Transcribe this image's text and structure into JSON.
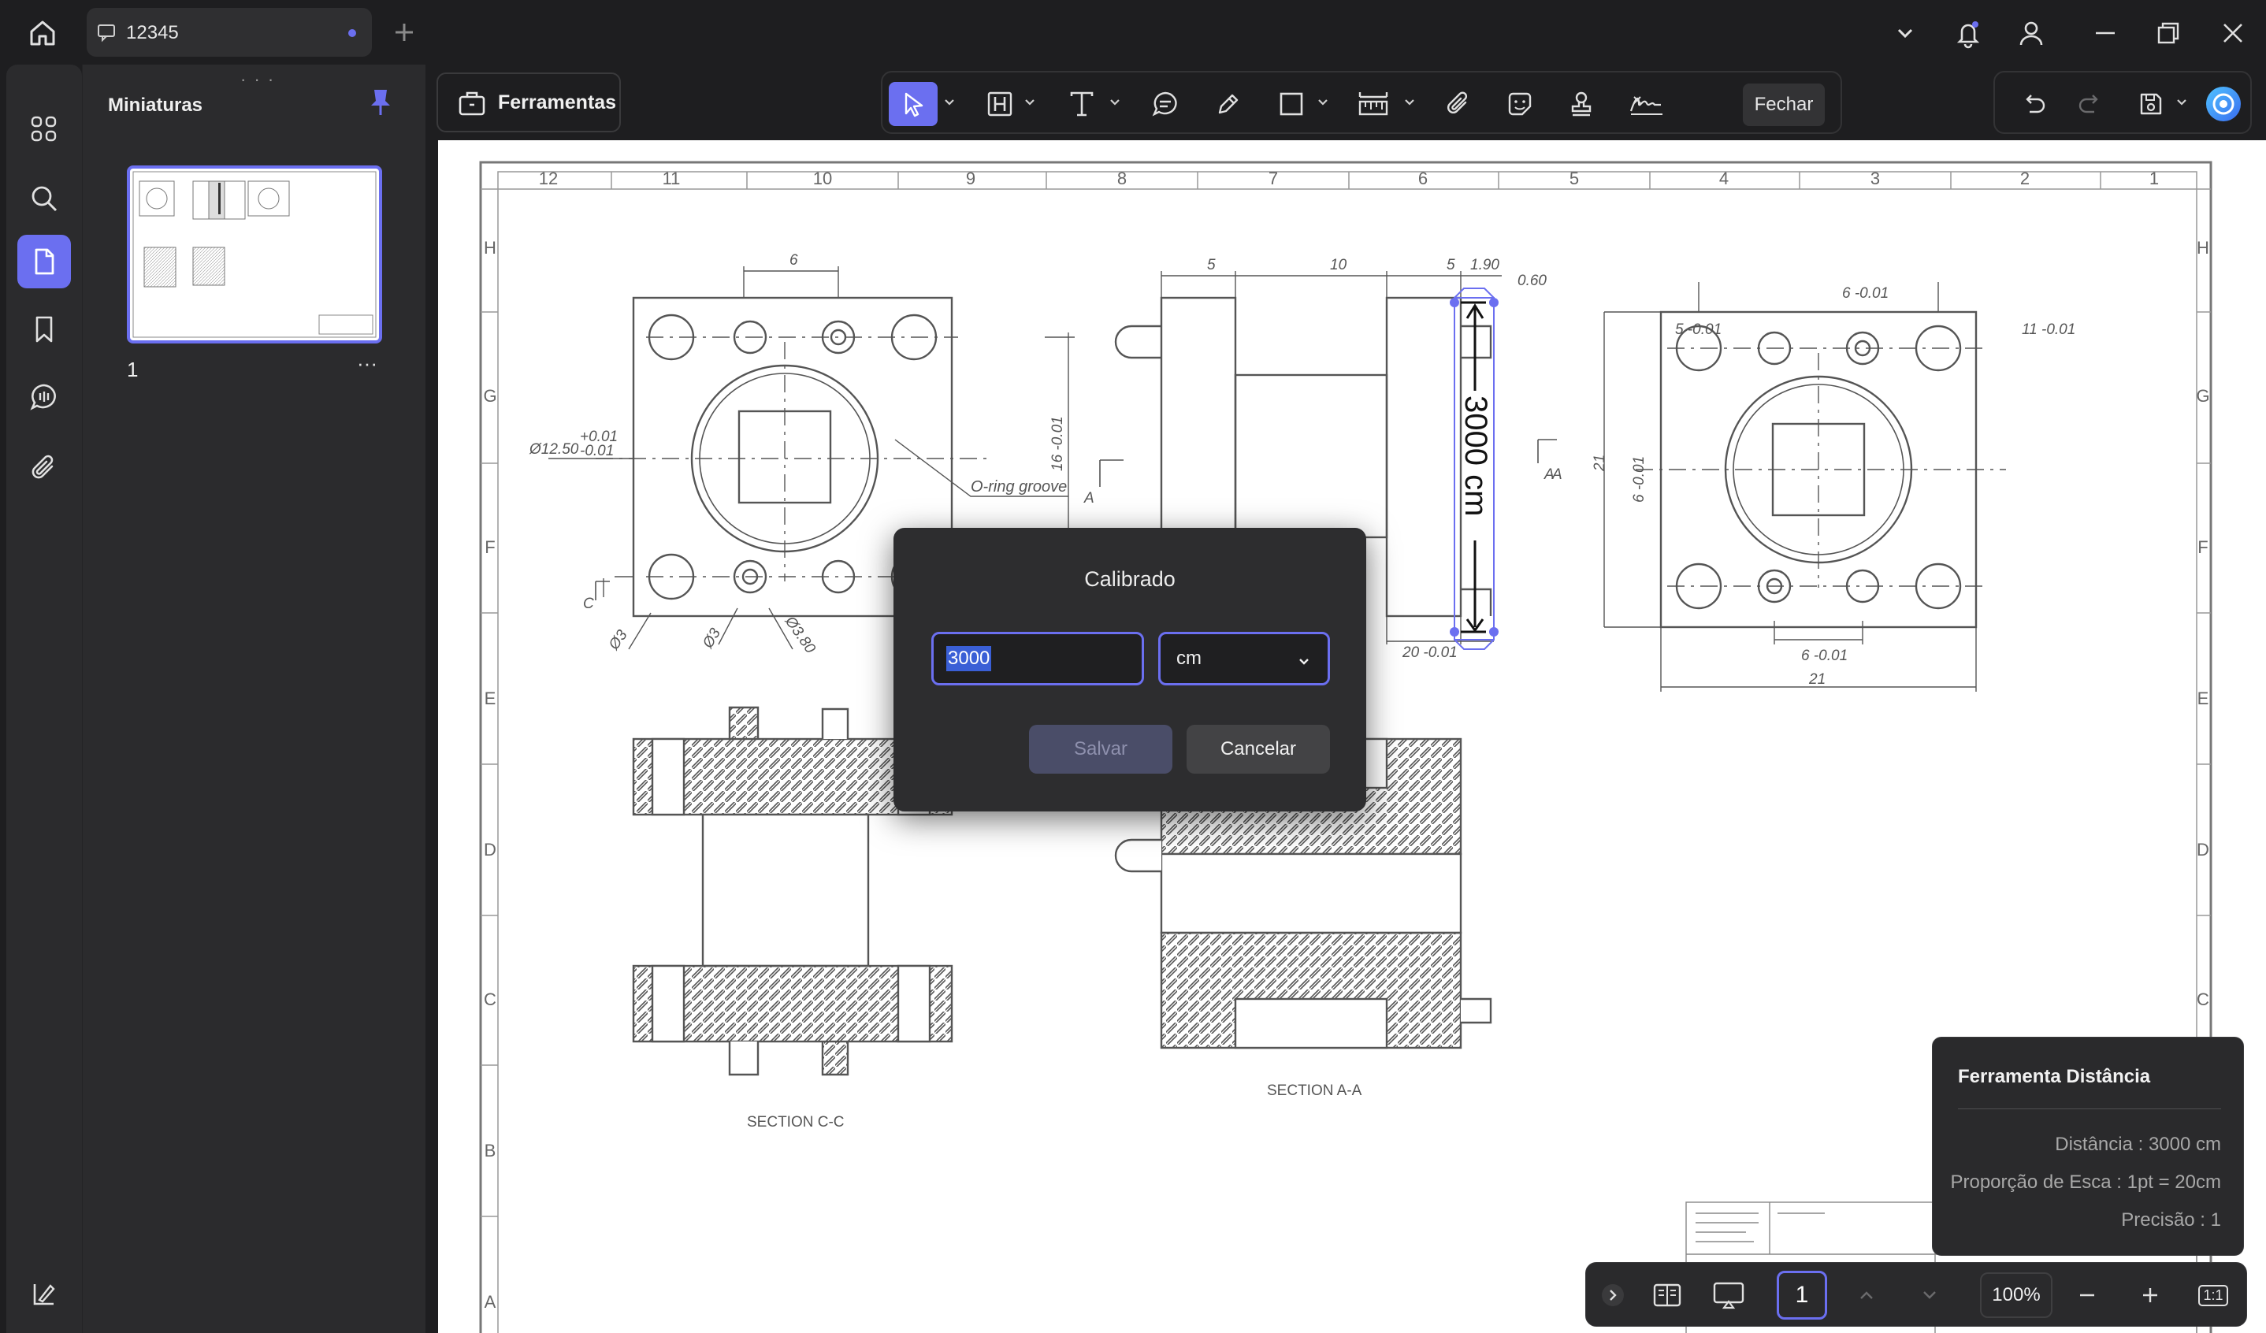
{
  "titlebar": {
    "tab_title": "12345",
    "icons": [
      "home-icon",
      "comment-icon",
      "plus-icon",
      "chevron-down-icon",
      "bell-icon",
      "user-icon",
      "minimize-icon",
      "restore-icon",
      "close-icon"
    ]
  },
  "colors": {
    "accent": "#6b6ff0",
    "background": "#1e1e20",
    "panel": "#2b2b2d",
    "page": "#ffffff"
  },
  "sidebar": {
    "title": "Miniaturas",
    "page_label": "1",
    "more_label": "···"
  },
  "toolbar": {
    "tools_label": "Ferramentas",
    "close_label": "Fechar"
  },
  "drawing": {
    "top_ruler": [
      "12",
      "11",
      "10",
      "9",
      "8",
      "7",
      "6",
      "5",
      "4",
      "3",
      "2",
      "1"
    ],
    "side_ruler": [
      "H",
      "G",
      "F",
      "E",
      "D",
      "C",
      "B",
      "A"
    ],
    "dims": {
      "d6": "6",
      "d5a": "5",
      "d10": "10",
      "d5b": "5",
      "d190": "1.90",
      "d060": "0.60",
      "dia1250": "Ø12.50",
      "tol_p001": "+0.01",
      "tol_m001": "-0.01",
      "d16": "16 -0.01",
      "d20": "20 -0.01",
      "d21a": "21",
      "d21b": "21",
      "d6r": "6 -0.01",
      "d5r": "5 -0.01",
      "d11r": "11 -0.01",
      "d6l": "6 -0.01",
      "d6b": "6 -0.01",
      "d3a": "Ø3",
      "d3b": "Ø3",
      "d3c": "Ø3.80",
      "oring": "O-ring groove",
      "sec_a": "A",
      "sec_a2": "A",
      "sec_a3": "A",
      "sec_c": "C",
      "sec_cc": "SECTION C-C",
      "sec_aa": "SECTION A-A"
    },
    "measure_label": "3000 cm"
  },
  "dialog": {
    "title": "Calibrado",
    "value": "3000",
    "unit": "cm",
    "save_label": "Salvar",
    "cancel_label": "Cancelar"
  },
  "measure_panel": {
    "title": "Ferramenta Distância",
    "distance": "Distância : 3000 cm",
    "scale": "Proporção de Esca : 1pt = 20cm",
    "precision": "Precisão : 1"
  },
  "bottombar": {
    "page": "1",
    "zoom": "100%",
    "fit_label": "1:1"
  }
}
